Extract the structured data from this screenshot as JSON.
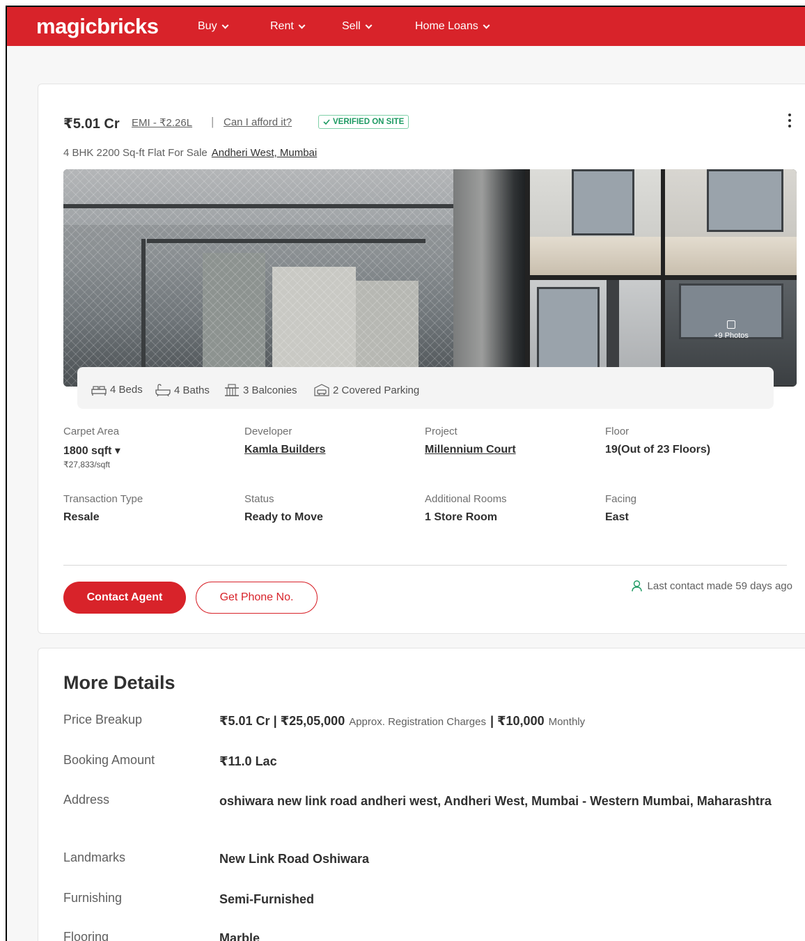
{
  "header": {
    "logo": "magicbricks",
    "nav": [
      "Buy",
      "Rent",
      "Sell",
      "Home Loans"
    ]
  },
  "listing": {
    "price": "₹5.01 Cr",
    "emi": "EMI - ₹2.26L",
    "separator": "|",
    "afford": "Can I afford it?",
    "verified": "VERIFIED ON SITE",
    "subtitle": "4 BHK 2200 Sq-ft Flat For Sale",
    "location": "Andheri West, Mumbai",
    "photos_badge": "+9 Photos",
    "features": [
      "4 Beds",
      "4 Baths",
      "3 Balconies",
      "2 Covered Parking"
    ],
    "fields": [
      {
        "label": "Carpet Area",
        "value": "1800 sqft ▾",
        "sub": "₹27,833/sqft"
      },
      {
        "label": "Developer",
        "value": "Kamla Builders"
      },
      {
        "label": "Project",
        "value": "Millennium Court"
      },
      {
        "label": "Floor",
        "value": "19(Out of 23 Floors)"
      },
      {
        "label": "Transaction Type",
        "value": "Resale"
      },
      {
        "label": "Status",
        "value": "Ready to Move"
      },
      {
        "label": "Additional Rooms",
        "value": "1 Store Room"
      },
      {
        "label": "Facing",
        "value": "East"
      }
    ],
    "contact_button": "Contact Agent",
    "phone_button": "Get Phone No.",
    "last_contact": "Last contact made 59 days ago"
  },
  "more_details": {
    "title": "More Details",
    "price_breakup": {
      "label": "Price Breakup",
      "price": "₹5.01 Cr | ₹25,05,000",
      "reg_note": "Approx. Registration Charges",
      "monthly_amount": "| ₹10,000",
      "monthly_note": "Monthly"
    },
    "rows": [
      {
        "label": "Booking Amount",
        "value": "₹11.0 Lac"
      },
      {
        "label": "Address",
        "value": "oshiwara new link road andheri west, Andheri West, Mumbai - Western Mumbai, Maharashtra"
      },
      {
        "label": "Landmarks",
        "value": "New Link Road Oshiwara"
      },
      {
        "label": "Furnishing",
        "value": "Semi-Furnished"
      },
      {
        "label": "Flooring",
        "value": "Marble"
      }
    ]
  },
  "colors": {
    "brand": "#d8232a",
    "verified": "#1d9a62"
  }
}
